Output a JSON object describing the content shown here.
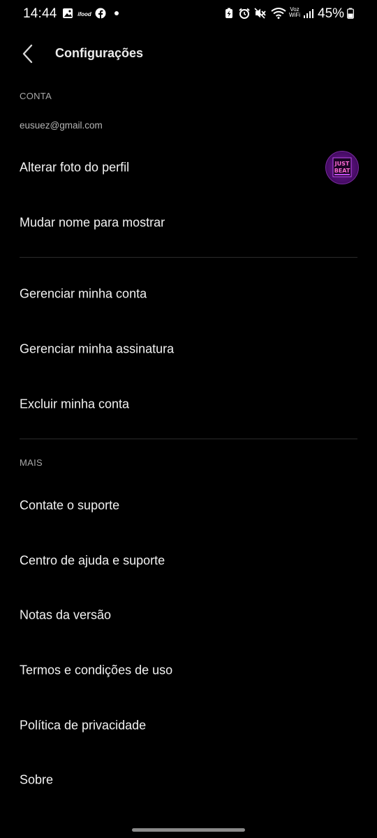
{
  "status_bar": {
    "time": "14:44",
    "battery_percent": "45%",
    "ifood_label": "ifood",
    "voz_label": "Voz",
    "wifi_label": "WiFi"
  },
  "header": {
    "title": "Configurações"
  },
  "account": {
    "section_title": "CONTA",
    "email": "eusuez@gmail.com",
    "items": [
      {
        "label": "Alterar foto do perfil"
      },
      {
        "label": "Mudar nome para mostrar"
      },
      {
        "label": "Gerenciar minha conta"
      },
      {
        "label": "Gerenciar minha assinatura"
      },
      {
        "label": "Excluir minha conta"
      }
    ]
  },
  "more": {
    "section_title": "MAIS",
    "items": [
      {
        "label": "Contate o suporte"
      },
      {
        "label": "Centro de ajuda e suporte"
      },
      {
        "label": "Notas da versão"
      },
      {
        "label": "Termos e condições de uso"
      },
      {
        "label": "Política de privacidade"
      },
      {
        "label": "Sobre"
      }
    ]
  },
  "avatar": {
    "text_line1": "JUST",
    "text_line2": "BEAT"
  },
  "colors": {
    "background": "#000000",
    "text_primary": "#f2f2f2",
    "text_secondary": "#a8a8a8",
    "divider": "#2b2b2b",
    "avatar_accent": "#6a1a8a"
  }
}
